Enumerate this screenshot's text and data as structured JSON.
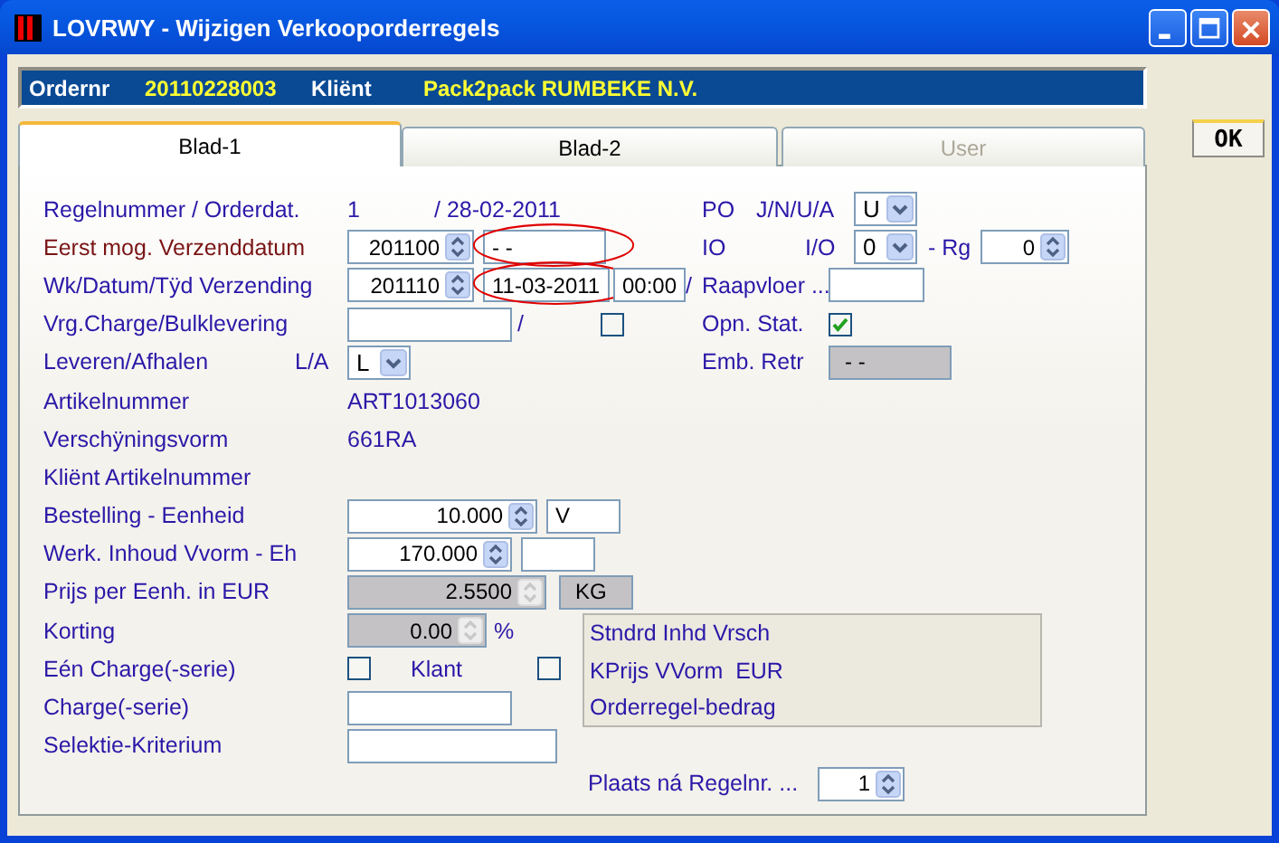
{
  "window": {
    "title": "LOVRWY - Wijzigen Verkooporderregels"
  },
  "header": [
    {
      "label": "Ordernr",
      "value": "20110228003"
    },
    {
      "label": "Kliënt",
      "value": "Pack2pack RUMBEKE N.V."
    }
  ],
  "tabs": [
    {
      "label": "Blad-1",
      "selected": true,
      "disabled": false
    },
    {
      "label": "Blad-2",
      "selected": false,
      "disabled": false
    },
    {
      "label": "User",
      "selected": false,
      "disabled": true
    }
  ],
  "ok_button": "OK",
  "rows": [
    {
      "label": "Regelnummer / Orderdat.",
      "controls": [
        {
          "kind": "text",
          "text": "1"
        },
        {
          "kind": "text",
          "text": "/ 28-02-2011"
        },
        {
          "kind": "text",
          "text": "PO"
        },
        {
          "kind": "text",
          "text": "J/N/U/A"
        },
        {
          "kind": "select",
          "value": "U"
        }
      ]
    },
    {
      "label": "Eerst mog. Verzenddatum",
      "emphasized": true,
      "controls": [
        {
          "kind": "spin",
          "value": "201100",
          "disabled": false
        },
        {
          "kind": "field",
          "value": "- -",
          "disabled": false,
          "circled": true
        },
        {
          "kind": "text",
          "text": "IO"
        },
        {
          "kind": "text",
          "text": "I/O"
        },
        {
          "kind": "select",
          "value": "0"
        },
        {
          "kind": "text",
          "text": "- Rg"
        },
        {
          "kind": "spin",
          "value": "0",
          "disabled": false
        }
      ]
    },
    {
      "label": "Wk/Datum/Tÿd Verzending",
      "controls": [
        {
          "kind": "spin",
          "value": "201110",
          "disabled": false
        },
        {
          "kind": "field",
          "value": "11-03-2011",
          "disabled": false,
          "circled": true
        },
        {
          "kind": "field",
          "value": "00:00",
          "disabled": false,
          "circled": false
        },
        {
          "kind": "text",
          "text": "/"
        },
        {
          "kind": "text",
          "text": "Raapvloer ..."
        },
        {
          "kind": "field",
          "disabled": false,
          "circled": false
        }
      ]
    },
    {
      "label": "Vrg.Charge/Bulklevering",
      "controls": [
        {
          "kind": "field",
          "disabled": false,
          "circled": false
        },
        {
          "kind": "text",
          "text": "/"
        },
        {
          "kind": "checkbox",
          "checked": false
        },
        {
          "kind": "text",
          "text": "Opn. Stat."
        },
        {
          "kind": "checkbox",
          "checked": true
        }
      ]
    },
    {
      "label": "Leveren/Afhalen",
      "controls": [
        {
          "kind": "text",
          "text": "L/A"
        },
        {
          "kind": "select",
          "value": "L"
        },
        {
          "kind": "text",
          "text": "Emb. Retr"
        },
        {
          "kind": "field",
          "value": "- -",
          "disabled": true,
          "circled": false
        }
      ]
    },
    {
      "label": "Artikelnummer",
      "controls": [
        {
          "kind": "text",
          "text": "ART1013060"
        }
      ]
    },
    {
      "label": "Verschÿningsvorm",
      "controls": [
        {
          "kind": "text",
          "text": "661RA"
        }
      ]
    },
    {
      "label": "Kliënt Artikelnummer",
      "controls": []
    },
    {
      "label": "Bestelling - Eenheid",
      "controls": [
        {
          "kind": "spin",
          "value": "10.000",
          "disabled": false
        },
        {
          "kind": "field",
          "value": "V",
          "disabled": false,
          "circled": false
        }
      ]
    },
    {
      "label": "Werk. Inhoud Vvorm - Eh",
      "controls": [
        {
          "kind": "spin",
          "value": "170.000",
          "disabled": false
        },
        {
          "kind": "field",
          "disabled": false,
          "circled": false
        }
      ]
    },
    {
      "label": "Prijs per Eenh. in EUR",
      "controls": [
        {
          "kind": "spin",
          "value": "2.5500",
          "disabled": true
        },
        {
          "kind": "field",
          "value": "KG",
          "disabled": true,
          "circled": false
        }
      ]
    },
    {
      "label": "Korting",
      "controls": [
        {
          "kind": "spin",
          "value": "0.00",
          "disabled": true
        },
        {
          "kind": "text",
          "text": "%"
        }
      ]
    },
    {
      "label": "Eén Charge(-serie)",
      "controls": [
        {
          "kind": "checkbox",
          "checked": false
        },
        {
          "kind": "text",
          "text": "Klant"
        },
        {
          "kind": "checkbox",
          "checked": false
        }
      ]
    },
    {
      "label": "Charge(-serie)",
      "controls": [
        {
          "kind": "field",
          "disabled": false,
          "circled": false
        }
      ]
    },
    {
      "label": "Selektie-Kriterium",
      "controls": [
        {
          "kind": "field",
          "disabled": false,
          "circled": false
        }
      ]
    },
    {
      "controls": [
        {
          "kind": "text",
          "text": "Plaats ná Regelnr. ..."
        },
        {
          "kind": "spin",
          "value": "1",
          "disabled": false
        }
      ]
    }
  ],
  "info_box": [
    "Stndrd Inhd Vrsch",
    "KPrijs VVorm  EUR",
    "Orderregel-bedrag"
  ]
}
